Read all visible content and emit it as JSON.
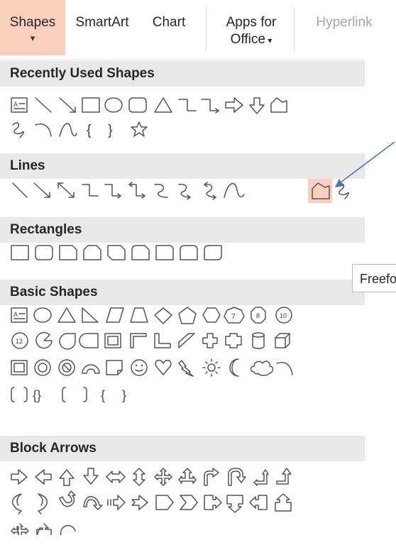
{
  "ribbon": {
    "shapes_label": "Shapes",
    "smartart_label": "SmartArt",
    "chart_label": "Chart",
    "apps_line1": "Apps for",
    "apps_line2": "Office",
    "hyperlink_label": "Hyperlink"
  },
  "sections": {
    "recent": "Recently Used Shapes",
    "lines": "Lines",
    "rectangles": "Rectangles",
    "basic": "Basic Shapes",
    "block_arrows": "Block Arrows"
  },
  "tooltip": "Freefor",
  "basic_numbers": [
    "7",
    "8",
    "10",
    "12"
  ],
  "colors": {
    "highlight": "#f9d0bd",
    "annotation_arrow": "#4472c4"
  }
}
